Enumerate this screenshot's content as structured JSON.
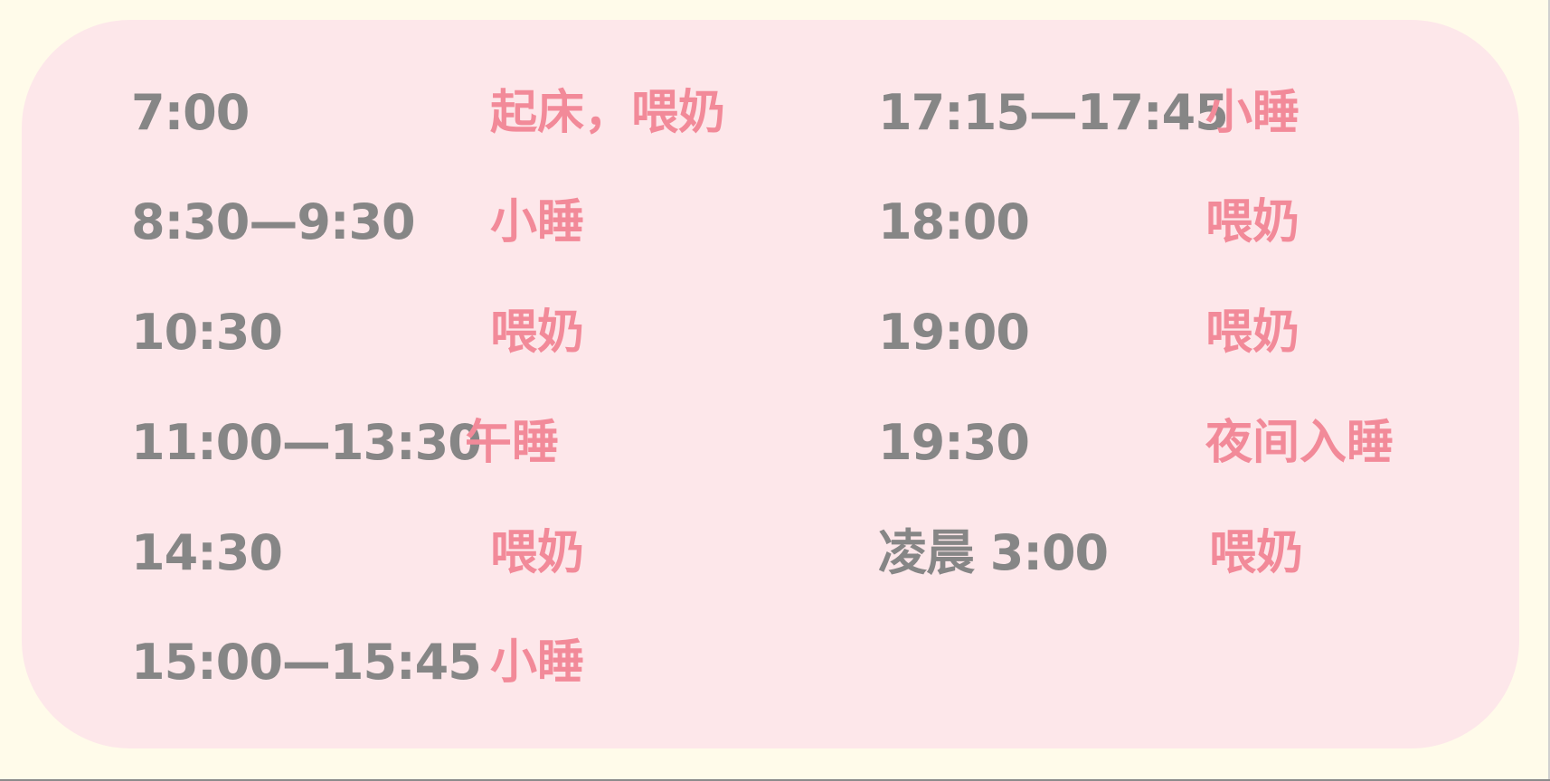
{
  "colors": {
    "page_background": "#fffbea",
    "card_background": "#fde7ea",
    "time_text": "#868686",
    "activity_text": "#f28a99"
  },
  "schedule": {
    "left": [
      {
        "time": "7:00",
        "activity": "起床，喂奶"
      },
      {
        "time": "8:30—9:30",
        "activity": "小睡"
      },
      {
        "time": "10:30",
        "activity": "喂奶"
      },
      {
        "time": "11:00—13:30",
        "activity": "午睡"
      },
      {
        "time": "14:30",
        "activity": "喂奶"
      },
      {
        "time": "15:00—15:45",
        "activity": "小睡"
      }
    ],
    "right": [
      {
        "time": "17:15—17:45",
        "activity": "小睡"
      },
      {
        "time": "18:00",
        "activity": "喂奶"
      },
      {
        "time": "19:00",
        "activity": "喂奶"
      },
      {
        "time": "19:30",
        "activity": "夜间入睡"
      },
      {
        "time": "凌晨 3:00",
        "activity": "喂奶"
      }
    ]
  }
}
